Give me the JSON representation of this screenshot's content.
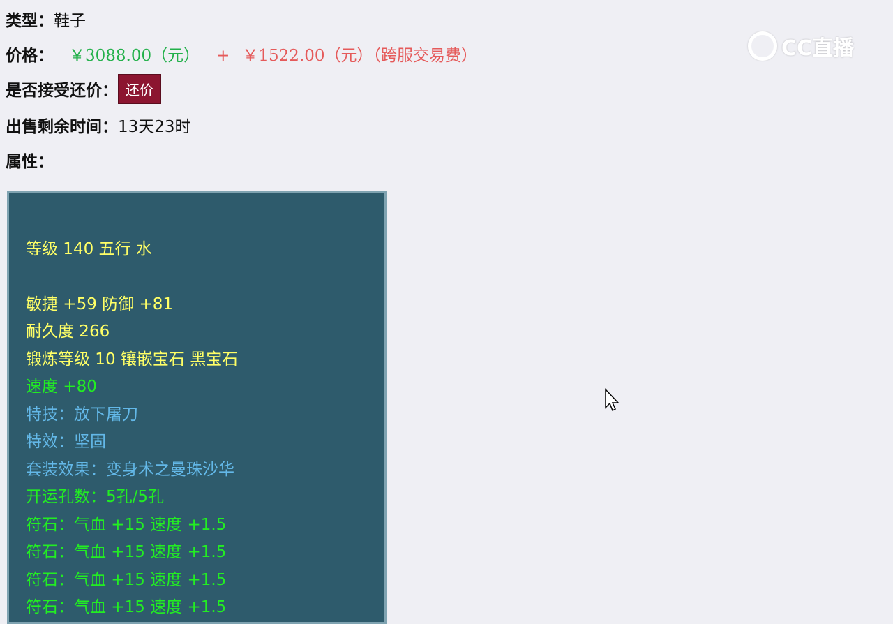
{
  "info": {
    "type_label": "类型：",
    "type_value": "鞋子",
    "price_label": "价格：",
    "price_main": "￥3088.00（元）",
    "price_plus": "+",
    "price_fee": "￥1522.00（元）",
    "price_fee_note": "（跨服交易费）",
    "bargain_label": "是否接受还价：",
    "bargain_button": "还价",
    "time_label": "出售剩余时间：",
    "time_value": "13天23时",
    "attr_label": "属性："
  },
  "logo_text": "CC直播",
  "attributes": [
    {
      "text": "等级 140 五行 水",
      "color": "yellow"
    },
    {
      "text": "敏捷 +59 防御 +81",
      "color": "yellow"
    },
    {
      "text": "耐久度 266",
      "color": "yellow"
    },
    {
      "text": "锻炼等级 10 镶嵌宝石 黑宝石",
      "color": "yellow"
    },
    {
      "text": "速度 +80",
      "color": "green"
    },
    {
      "text": "特技：放下屠刀",
      "color": "blue"
    },
    {
      "text": "特效：坚固",
      "color": "blue"
    },
    {
      "text": "套装效果：变身术之曼珠沙华",
      "color": "blue"
    },
    {
      "text": "开运孔数：5孔/5孔",
      "color": "green"
    },
    {
      "text": "符石：气血 +15 速度 +1.5",
      "color": "green"
    },
    {
      "text": "符石：气血 +15 速度 +1.5",
      "color": "green"
    },
    {
      "text": "符石：气血 +15 速度 +1.5",
      "color": "green"
    },
    {
      "text": "符石：气血 +15 速度 +1.5",
      "color": "green"
    }
  ],
  "colors": {
    "background": "#efeff4",
    "panel": "#2e5b6c",
    "price_green": "#22b04a",
    "price_red": "#e55a5a",
    "button": "#8c1530"
  }
}
